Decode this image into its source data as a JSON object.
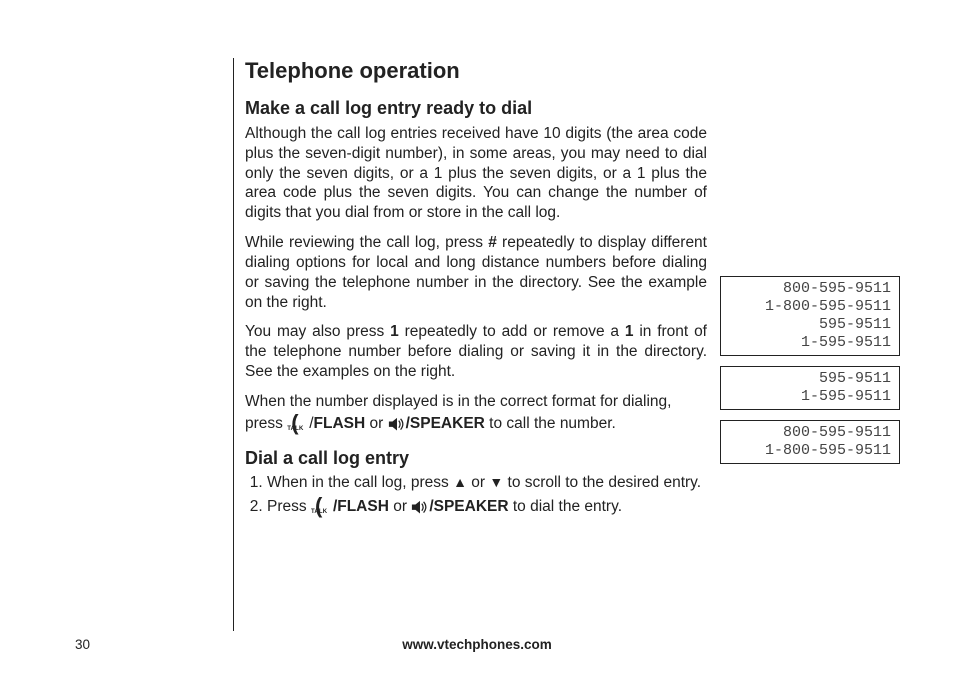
{
  "title": "Telephone operation",
  "section1": {
    "heading": "Make a call log entry ready to dial",
    "para1": "Although the call log entries received have 10 digits (the area code plus the seven-digit number), in some areas, you may need to dial only the seven digits, or a 1 plus the seven digits, or a 1 plus the area code plus the seven digits. You can change the number of digits that you dial from or store in the call log.",
    "para2a": "While reviewing the call log, press ",
    "para2_key": "#",
    "para2b": " repeatedly to display different dialing options for local and long distance numbers before dialing or saving the telephone number in the directory. See the example on the right.",
    "para3a": "You may also press ",
    "para3_key1": "1",
    "para3b": " repeatedly to add or remove a ",
    "para3_key2": "1",
    "para3c": " in front of the telephone number before dialing or saving it in the directory. See the examples on the right.",
    "para4": "When the number displayed is in the correct format for dialing,",
    "para5a": "press ",
    "talk_label": "TALK",
    "flash_label": "FLASH",
    "or_text": " or  ",
    "speaker_label": "/SPEAKER",
    "para5b": " to call the number."
  },
  "section2": {
    "heading": "Dial a call log entry",
    "step1a": "When in the call log, press ",
    "step1b": " or ",
    "step1c": " to scroll to the desired entry.",
    "step2a": "Press ",
    "step2_flash": "/FLASH",
    "step2_or": " or ",
    "step2_speaker": "/SPEAKER",
    "step2b": " to dial the entry."
  },
  "examples": {
    "box1": [
      "800-595-9511",
      "1-800-595-9511",
      "595-9511",
      "1-595-9511"
    ],
    "box2": [
      "595-9511",
      "1-595-9511"
    ],
    "box3": [
      "800-595-9511",
      "1-800-595-9511"
    ]
  },
  "footer": {
    "page_number": "30",
    "url": "www.vtechphones.com"
  }
}
